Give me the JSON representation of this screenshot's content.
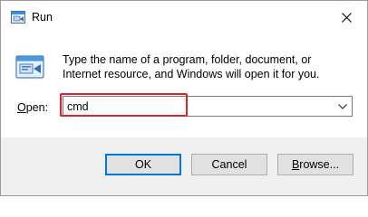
{
  "window": {
    "title": "Run",
    "close_icon": "close-icon",
    "app_icon": "run-app-icon"
  },
  "main": {
    "description": "Type the name of a program, folder, document, or Internet resource, and Windows will open it for you.",
    "icon": "run-icon"
  },
  "open": {
    "label_prefix": "",
    "label_accel": "O",
    "label_rest": "pen:",
    "value": "cmd",
    "dropdown_icon": "chevron-down-icon"
  },
  "buttons": {
    "ok": "OK",
    "cancel": "Cancel",
    "browse_accel": "B",
    "browse_rest": "rowse..."
  },
  "colors": {
    "highlight": "#e0202a",
    "default_button_border": "#0078d7",
    "dialog_bg": "#f0f0f0"
  }
}
